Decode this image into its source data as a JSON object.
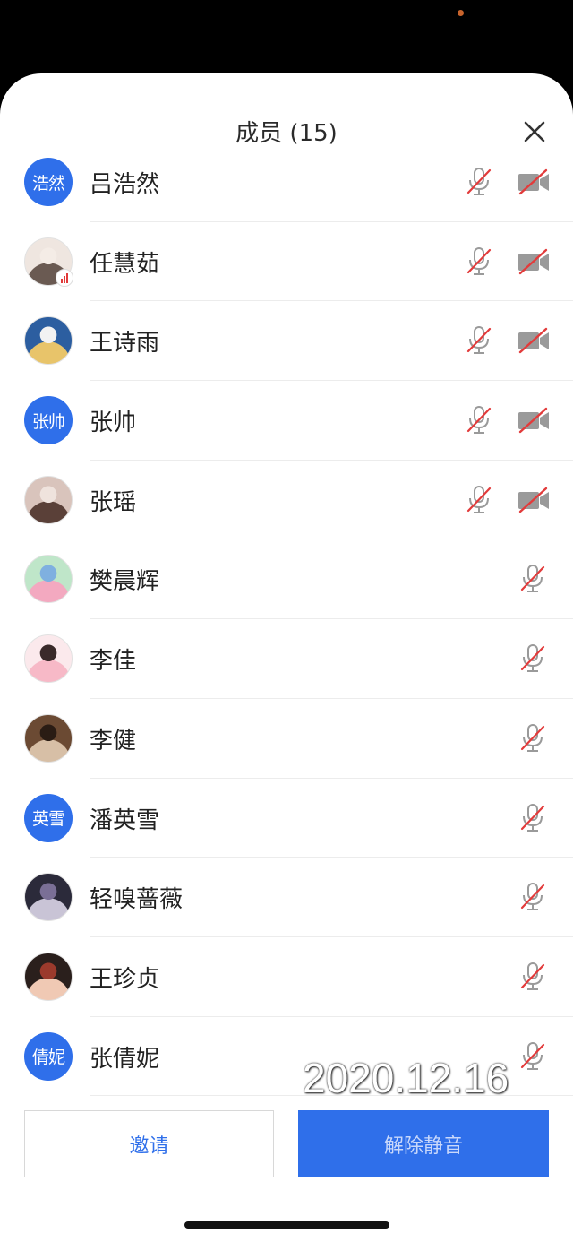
{
  "header": {
    "title": "成员 (15)"
  },
  "members": [
    {
      "name": "吕浩然",
      "avatar_text": "浩然",
      "avatar_type": "text",
      "mic_muted": true,
      "camera_off": true
    },
    {
      "name": "任慧茹",
      "avatar_type": "photo",
      "avatar_palette": [
        "#efe6e0",
        "#6a5a52",
        "#f4ece6"
      ],
      "speaking_badge": true,
      "mic_muted": true,
      "camera_off": true
    },
    {
      "name": "王诗雨",
      "avatar_type": "photo",
      "avatar_palette": [
        "#2c5ea0",
        "#e8c46a",
        "#f2f2f2"
      ],
      "mic_muted": true,
      "camera_off": true
    },
    {
      "name": "张帅",
      "avatar_text": "张帅",
      "avatar_type": "text",
      "mic_muted": true,
      "camera_off": true
    },
    {
      "name": "张瑶",
      "avatar_type": "photo",
      "avatar_palette": [
        "#d9c4bc",
        "#5a4038",
        "#efe3dd"
      ],
      "mic_muted": true,
      "camera_off": true
    },
    {
      "name": "樊晨辉",
      "avatar_type": "photo",
      "avatar_palette": [
        "#bfe6c9",
        "#f3a9c0",
        "#7fb0e0"
      ],
      "mic_muted": true
    },
    {
      "name": "李佳",
      "avatar_type": "photo",
      "avatar_palette": [
        "#fbe9ec",
        "#f7b9c7",
        "#3a2a2a"
      ],
      "mic_muted": true
    },
    {
      "name": "李健",
      "avatar_type": "photo",
      "avatar_palette": [
        "#6b4a33",
        "#d7bfa6",
        "#2a1c14"
      ],
      "mic_muted": true
    },
    {
      "name": "潘英雪",
      "avatar_text": "英雪",
      "avatar_type": "text",
      "mic_muted": true
    },
    {
      "name": "轻嗅蔷薇",
      "avatar_type": "photo",
      "avatar_palette": [
        "#2b2a3a",
        "#c9c4d6",
        "#7a6f96"
      ],
      "mic_muted": true
    },
    {
      "name": "王珍贞",
      "avatar_type": "photo",
      "avatar_palette": [
        "#2a1f1c",
        "#f0c9b4",
        "#9b3a2c"
      ],
      "mic_muted": true
    },
    {
      "name": "张倩妮",
      "avatar_text": "倩妮",
      "avatar_type": "text",
      "mic_muted": true
    }
  ],
  "footer": {
    "invite_label": "邀请",
    "unmute_label": "解除静音"
  },
  "overlay": {
    "date_stamp": "2020.12.16"
  },
  "icons": {
    "close": "close-icon",
    "mic_muted": "mic-muted-icon",
    "camera_off": "camera-off-icon"
  },
  "colors": {
    "accent": "#2f6fea",
    "muted_red": "#e23b3b",
    "icon_gray": "#9a9a9a"
  }
}
